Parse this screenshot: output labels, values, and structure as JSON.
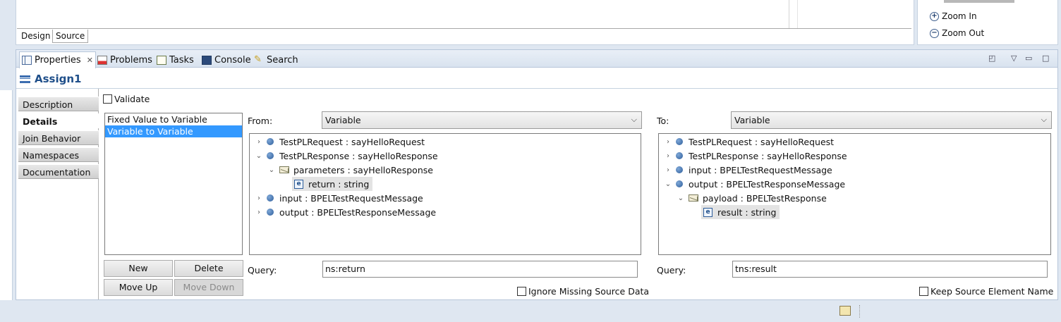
{
  "editor": {
    "tabs": [
      "Design",
      "Source"
    ]
  },
  "palette": {
    "zoom_in": "Zoom In",
    "zoom_out": "Zoom Out"
  },
  "view_tabs": [
    {
      "label": "Properties",
      "icon": "properties-icon",
      "active": true
    },
    {
      "label": "Problems",
      "icon": "problems-icon"
    },
    {
      "label": "Tasks",
      "icon": "tasks-icon"
    },
    {
      "label": "Console",
      "icon": "console-icon"
    },
    {
      "label": "Search",
      "icon": "search-icon"
    }
  ],
  "title": "Assign1",
  "section_tabs": [
    "Description",
    "Details",
    "Join Behavior",
    "Namespaces",
    "Documentation"
  ],
  "active_section": "Details",
  "validate_label": "Validate",
  "type_list": [
    "Fixed Value to Variable",
    "Variable to Variable"
  ],
  "selected_type": "Variable to Variable",
  "buttons": {
    "new": "New",
    "delete": "Delete",
    "move_up": "Move Up",
    "move_down": "Move Down"
  },
  "from": {
    "label": "From:",
    "combo": "Variable",
    "tree": [
      {
        "text": "TestPLRequest : sayHelloRequest",
        "expander": "collapsed",
        "icon": "variable-icon"
      },
      {
        "text": "TestPLResponse : sayHelloResponse",
        "expander": "expanded",
        "icon": "variable-icon"
      },
      {
        "text": "parameters : sayHelloResponse",
        "expander": "expanded",
        "icon": "message-part-icon"
      },
      {
        "text": "return : string",
        "expander": "none",
        "icon": "element-icon",
        "selected": true
      },
      {
        "text": "input : BPELTestRequestMessage",
        "expander": "collapsed",
        "icon": "variable-icon"
      },
      {
        "text": "output : BPELTestResponseMessage",
        "expander": "collapsed",
        "icon": "variable-icon"
      }
    ],
    "query_label": "Query:",
    "query_value": "ns:return",
    "option": "Ignore Missing Source Data"
  },
  "to": {
    "label": "To:",
    "combo": "Variable",
    "tree": [
      {
        "text": "TestPLRequest : sayHelloRequest",
        "expander": "collapsed",
        "icon": "variable-icon"
      },
      {
        "text": "TestPLResponse : sayHelloResponse",
        "expander": "collapsed",
        "icon": "variable-icon"
      },
      {
        "text": "input : BPELTestRequestMessage",
        "expander": "collapsed",
        "icon": "variable-icon"
      },
      {
        "text": "output : BPELTestResponseMessage",
        "expander": "expanded",
        "icon": "variable-icon"
      },
      {
        "text": "payload : BPELTestResponse",
        "expander": "expanded",
        "icon": "message-part-icon"
      },
      {
        "text": "result : string",
        "expander": "none",
        "icon": "element-icon",
        "selected": true
      }
    ],
    "query_label": "Query:",
    "query_value": "tns:result",
    "option": "Keep Source Element Name"
  }
}
